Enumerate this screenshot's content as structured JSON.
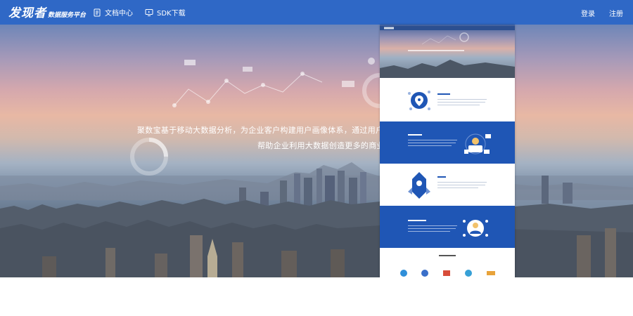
{
  "header": {
    "logo_main": "发现者",
    "logo_sub": "数据服务平台",
    "nav": [
      {
        "label": "文档中心",
        "icon": "document-icon"
      },
      {
        "label": "SDK下载",
        "icon": "monitor-icon"
      }
    ],
    "login_label": "登录",
    "register_label": "注册"
  },
  "hero": {
    "line1": "聚数宝基于移动大数据分析，为企业客户构建用户画像体系，通过用户细分",
    "line2": "帮助企业利用大数据创造更多的商业价"
  },
  "colors": {
    "header_bg": "#2f68c6",
    "preview_blue": "#1f56b5",
    "text_white": "#ffffff"
  }
}
